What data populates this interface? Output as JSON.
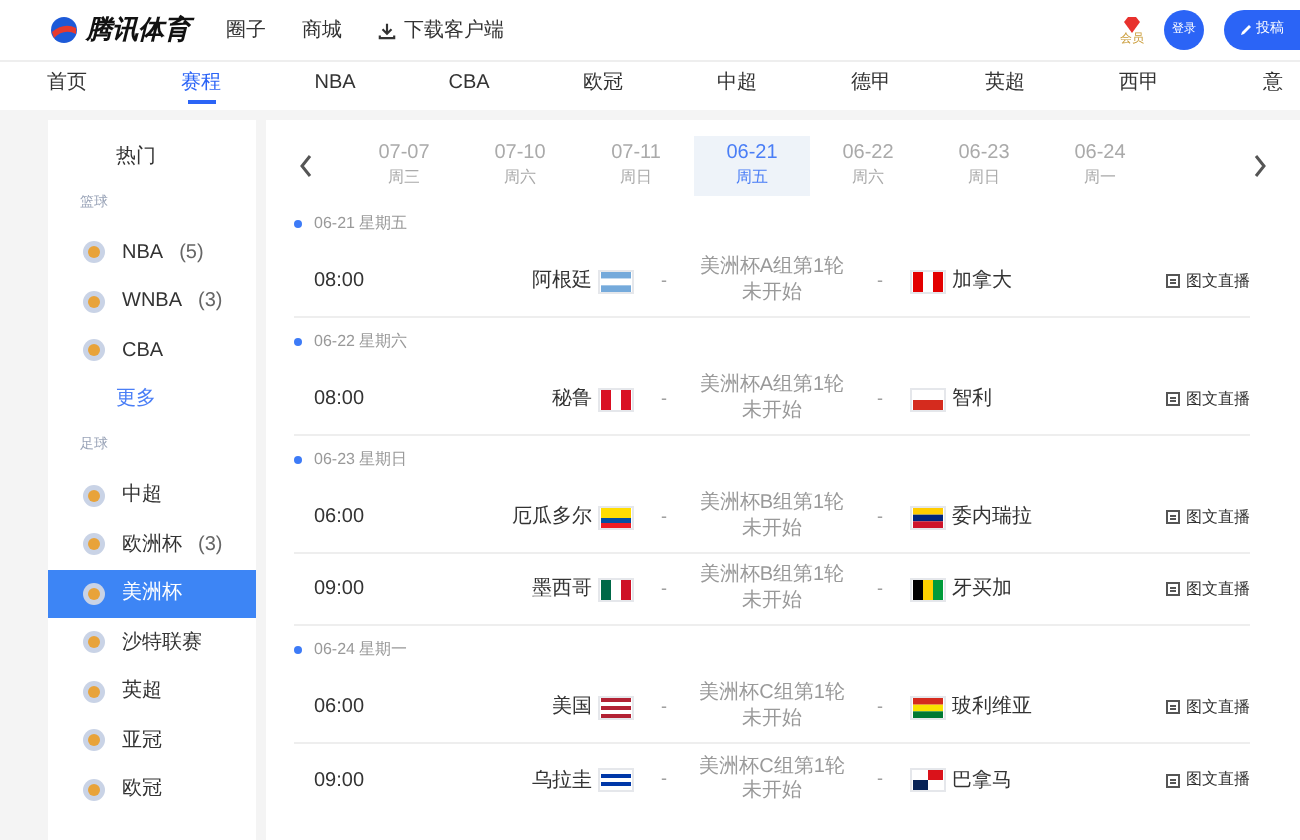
{
  "header": {
    "logo_text": "腾讯体育",
    "links": [
      {
        "label": "圈子",
        "kind": "text"
      },
      {
        "label": "商城",
        "kind": "text"
      },
      {
        "label": "下载客户端",
        "kind": "download"
      }
    ],
    "vip_label": "会员",
    "login": "登录",
    "post": "投稿"
  },
  "nav": [
    {
      "label": "首页",
      "selected": false
    },
    {
      "label": "赛程",
      "selected": true
    },
    {
      "label": "NBA",
      "selected": false
    },
    {
      "label": "CBA",
      "selected": false
    },
    {
      "label": "欧冠",
      "selected": false
    },
    {
      "label": "中超",
      "selected": false
    },
    {
      "label": "德甲",
      "selected": false
    },
    {
      "label": "英超",
      "selected": false
    },
    {
      "label": "西甲",
      "selected": false
    },
    {
      "label": "意",
      "selected": false
    }
  ],
  "sidebar": {
    "hot": "热门",
    "sections": [
      {
        "label": "篮球",
        "more": "更多",
        "items": [
          {
            "name": "NBA",
            "count": "(5)",
            "selected": false
          },
          {
            "name": "WNBA",
            "count": "(3)",
            "selected": false
          },
          {
            "name": "CBA",
            "selected": false
          }
        ]
      },
      {
        "label": "足球",
        "items": [
          {
            "name": "中超",
            "selected": false
          },
          {
            "name": "欧洲杯",
            "count": "(3)",
            "selected": false
          },
          {
            "name": "美洲杯",
            "selected": true
          },
          {
            "name": "沙特联赛",
            "selected": false
          },
          {
            "name": "英超",
            "selected": false
          },
          {
            "name": "亚冠",
            "selected": false
          },
          {
            "name": "欧冠",
            "selected": false
          }
        ]
      }
    ]
  },
  "dates": [
    {
      "date": "07-07",
      "weekday": "周三",
      "selected": false
    },
    {
      "date": "07-10",
      "weekday": "周六",
      "selected": false
    },
    {
      "date": "07-11",
      "weekday": "周日",
      "selected": false
    },
    {
      "date": "06-21",
      "weekday": "周五",
      "selected": true
    },
    {
      "date": "06-22",
      "weekday": "周六",
      "selected": false
    },
    {
      "date": "06-23",
      "weekday": "周日",
      "selected": false
    },
    {
      "date": "06-24",
      "weekday": "周一",
      "selected": false
    }
  ],
  "days": [
    {
      "heading": "06-21 星期五",
      "matches": [
        {
          "time": "08:00",
          "home": {
            "name": "阿根廷",
            "kind": "argentina"
          },
          "round": "美洲杯A组第1轮",
          "status": "未开始",
          "away": {
            "name": "加拿大",
            "kind": "canada"
          },
          "live": "图文直播",
          "home_score": "-",
          "away_score": "-"
        }
      ]
    },
    {
      "heading": "06-22 星期六",
      "matches": [
        {
          "time": "08:00",
          "home": {
            "name": "秘鲁",
            "kind": "peru"
          },
          "round": "美洲杯A组第1轮",
          "status": "未开始",
          "away": {
            "name": "智利",
            "kind": "chile"
          },
          "live": "图文直播",
          "home_score": "-",
          "away_score": "-"
        }
      ]
    },
    {
      "heading": "06-23 星期日",
      "matches": [
        {
          "time": "06:00",
          "home": {
            "name": "厄瓜多尔",
            "kind": "ecuador"
          },
          "round": "美洲杯B组第1轮",
          "status": "未开始",
          "away": {
            "name": "委内瑞拉",
            "kind": "venezuela"
          },
          "live": "图文直播",
          "home_score": "-",
          "away_score": "-"
        },
        {
          "time": "09:00",
          "home": {
            "name": "墨西哥",
            "kind": "mexico"
          },
          "round": "美洲杯B组第1轮",
          "status": "未开始",
          "away": {
            "name": "牙买加",
            "kind": "jamaica"
          },
          "live": "图文直播",
          "home_score": "-",
          "away_score": "-"
        }
      ]
    },
    {
      "heading": "06-24 星期一",
      "matches": [
        {
          "time": "06:00",
          "home": {
            "name": "美国",
            "kind": "usa"
          },
          "round": "美洲杯C组第1轮",
          "status": "未开始",
          "away": {
            "name": "玻利维亚",
            "kind": "bolivia"
          },
          "live": "图文直播",
          "home_score": "-",
          "away_score": "-"
        },
        {
          "time": "09:00",
          "home": {
            "name": "乌拉圭",
            "kind": "uruguay"
          },
          "round": "美洲杯C组第1轮",
          "status": "未开始",
          "away": {
            "name": "巴拿马",
            "kind": "panama"
          },
          "live": "图文直播",
          "home_score": "-",
          "away_score": "-"
        }
      ]
    }
  ]
}
